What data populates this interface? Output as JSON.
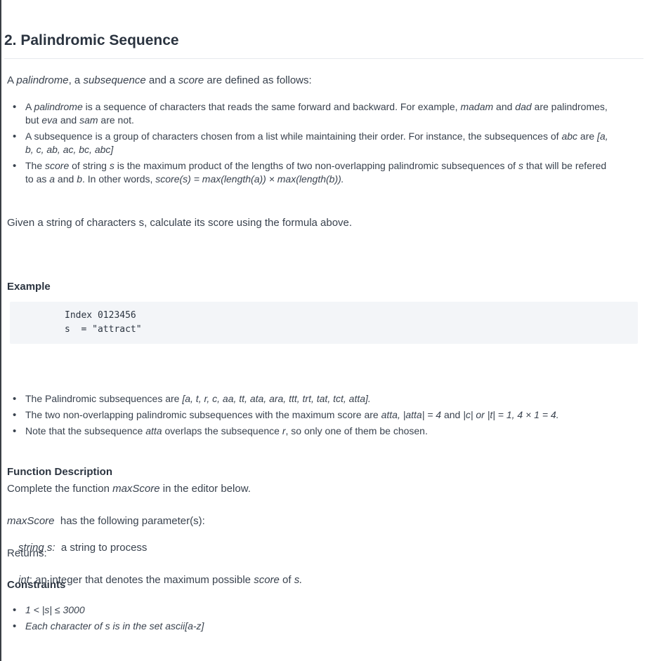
{
  "title": "2. Palindromic Sequence",
  "intro": {
    "t1": "A ",
    "e1": "palindrome",
    "t2": ", a ",
    "e2": "subsequence",
    "t3": " and a ",
    "e3": "score",
    "t4": " are defined as follows:"
  },
  "definitions": {
    "d1": {
      "a": "A ",
      "b": "palindrome",
      "c": " is a sequence of characters that reads the same forward and backward. For example, ",
      "d": "madam",
      "e": " and ",
      "f": "dad",
      "g": " are palindromes,",
      "h": "but ",
      "i": "eva",
      "j": " and ",
      "k": "sam",
      "l": " are not."
    },
    "d2": {
      "a": "A subsequence is a group of characters chosen from a list while maintaining their order. For instance, the subsequences of ",
      "b": "abc",
      "c": " are ",
      "d": "[a,",
      "e": "b, c, ab, ac, bc, abc]"
    },
    "d3": {
      "a": "The ",
      "b": "score",
      "c": " of string ",
      "d": "s",
      "e": " is the maximum product of the lengths of two non-overlapping palindromic subsequences of ",
      "f": "s",
      "g": " that will be refered",
      "h": "to as ",
      "i": "a",
      "j": " and ",
      "k": "b",
      "l": ". In other words, ",
      "m": "score(s) = max(length(a)) × max(length(b))."
    }
  },
  "task": "Given a string of characters s, calculate its score using the formula above.",
  "example": {
    "heading": "Example",
    "code_line1": "Index 0123456",
    "code_line2": "s  = \"attract\"",
    "b1": {
      "a": "The Palindromic subsequences are ",
      "b": "[a, t, r, c, aa, tt, ata, ara, ttt, trt, tat, tct, atta]."
    },
    "b2": {
      "a": "The two non-overlapping palindromic subsequences with the maximum score are ",
      "b": "atta, |atta| = 4",
      "c": " and ",
      "d": "|c| or |t| = 1, 4 × 1 = 4."
    },
    "b3": {
      "a": "Note that the subsequence ",
      "b": "atta",
      "c": " overlaps the subsequence ",
      "d": "r",
      "e": ", so only one of them be chosen."
    }
  },
  "function_description": {
    "heading": "Function Description",
    "line_a": "Complete the function ",
    "fn_name": "maxScore",
    "line_b": " in the editor below.",
    "sig_name": "maxScore",
    "sig_rest": "  has the following parameter(s):",
    "param_name": "string s:",
    "param_desc": "  a string to process",
    "returns_label": "Returns:",
    "ret_type": "int",
    "ret_a": ": an integer that denotes the maximum possible ",
    "ret_b": "score",
    "ret_c": " of ",
    "ret_d": "s."
  },
  "constraints": {
    "heading": "Constraints",
    "c1": "1 < |s| ≤ 3000",
    "c2": "Each character of s is in the set ascii[a-z]"
  }
}
